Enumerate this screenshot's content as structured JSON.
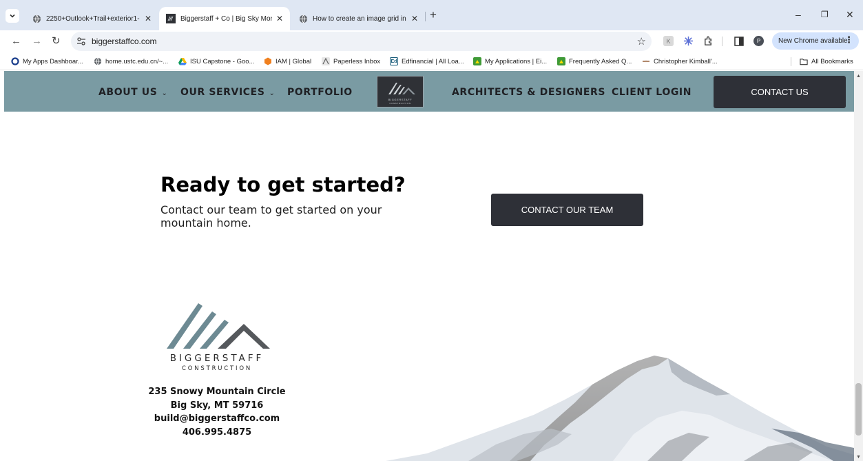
{
  "browser": {
    "tabs": [
      {
        "title": "2250+Outlook+Trail+exterior1-",
        "active": false
      },
      {
        "title": "Biggerstaff + Co | Big Sky Mont",
        "active": true
      },
      {
        "title": "How to create an image grid in",
        "active": false
      }
    ],
    "url": "biggerstaffco.com",
    "profile_initial": "P",
    "update_label": "New Chrome available",
    "bookmarks": [
      "My Apps Dashboar...",
      "home.ustc.edu.cn/~...",
      "ISU Capstone - Goo...",
      "IAM | Global",
      "Paperless Inbox",
      "Edfinancial | All Loa...",
      "My Applications | Ei...",
      "Frequently Asked Q...",
      "Christopher Kimball'..."
    ],
    "all_bookmarks_label": "All Bookmarks",
    "edfinancial_icon_text": "Ed"
  },
  "site": {
    "nav": {
      "about": "ABOUT US",
      "services": "OUR SERVICES",
      "portfolio": "PORTFOLIO",
      "architects": "ARCHITECTS & DESIGNERS",
      "client_login": "CLIENT LOGIN",
      "contact": "CONTACT US",
      "logo_line1": "BIGGERSTAFF",
      "logo_line2": "CONSTRUCTION"
    },
    "cta": {
      "heading": "Ready to get started?",
      "text": "Contact our team to get started on your mountain home.",
      "button": "CONTACT OUR TEAM"
    },
    "footer": {
      "brand_name": "BIGGERSTAFF",
      "brand_sub": "CONSTRUCTION",
      "address_line1": "235 Snowy Mountain Circle",
      "address_line2": "Big Sky, MT 59716",
      "email": "build@biggerstaffco.com",
      "phone": "406.995.4875"
    },
    "colors": {
      "nav_background": "#7a9ba3",
      "button_dark": "#2e3037",
      "logo_slate": "#6d8a93",
      "logo_gray": "#55585c"
    }
  }
}
